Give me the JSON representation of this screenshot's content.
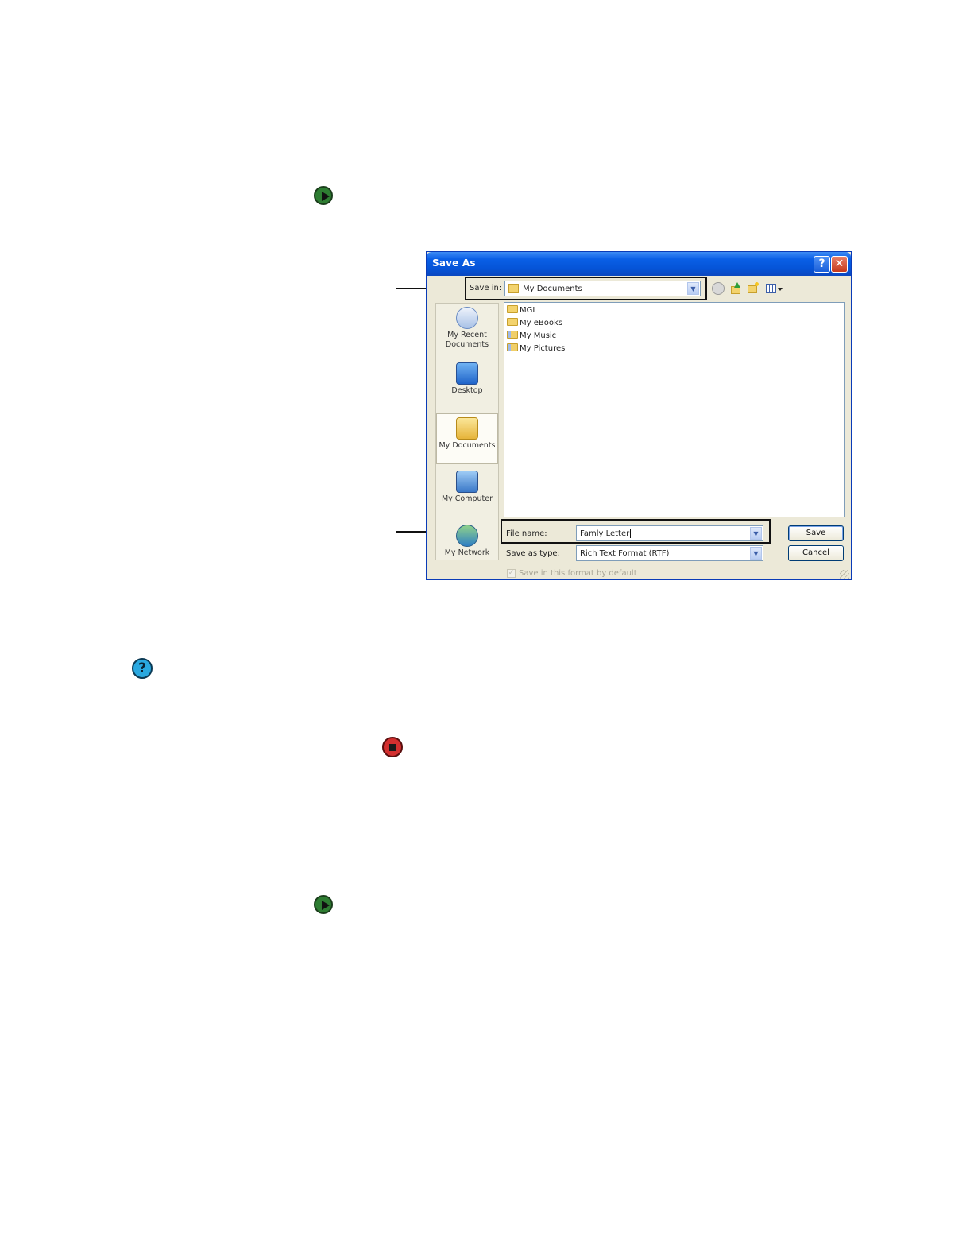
{
  "dialog": {
    "title": "Save As",
    "help_glyph": "?",
    "close_glyph": "✕",
    "save_in_label": "Save in:",
    "save_in_value": "My Documents",
    "toolbar_icons": [
      "back-icon",
      "up-folder-icon",
      "new-folder-icon",
      "views-menu-icon"
    ],
    "places": [
      {
        "label": "My Recent Documents",
        "icon": "recent-documents-icon"
      },
      {
        "label": "Desktop",
        "icon": "desktop-icon"
      },
      {
        "label": "My Documents",
        "icon": "my-documents-icon"
      },
      {
        "label": "My Computer",
        "icon": "my-computer-icon"
      },
      {
        "label": "My Network",
        "icon": "my-network-icon"
      }
    ],
    "files": [
      "MGI",
      "My eBooks",
      "My Music",
      "My Pictures"
    ],
    "file_name_label": "File name:",
    "file_name_value": "Famly Letter",
    "save_type_label": "Save as type:",
    "save_type_value": "Rich Text Format (RTF)",
    "save_button": "Save",
    "cancel_button": "Cancel",
    "default_format_label": "Save in this format by default"
  },
  "colors": {
    "titlebar": "#0554d7",
    "dialog_bg": "#ece9d8",
    "play_icon": "#2e7d32",
    "help_icon": "#29a8e0",
    "stop_icon": "#d32f2f"
  }
}
